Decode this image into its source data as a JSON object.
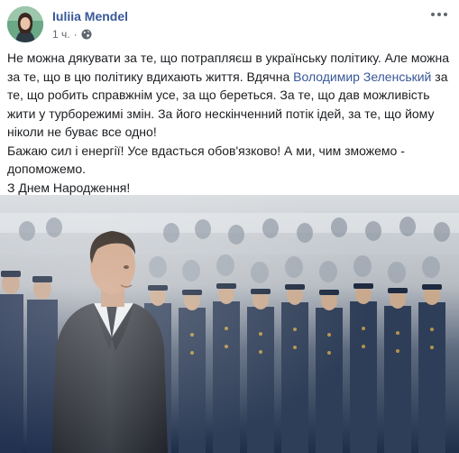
{
  "post": {
    "author": "Iuliia Mendel",
    "time": "1 ч.",
    "separator": "·",
    "privacy_icon": "globe-icon",
    "menu_icon": "more-options-icon",
    "text": {
      "p1_part1": "Не можна дякувати за те, що потрапляєш в українську політику. Але можна за те, що в цю політику вдихають життя. Вдячна ",
      "mention": "Володимир Зеленський",
      "p1_part2": " за те, що робить справжнім усе, за що береться. За те, що дав можливість жити у турборежимі змін. За його нескінченний потік ідей, за те, що йому ніколи не буває все одно!",
      "p2": "Бажаю сил і енергії! Усе вдасться обов'язково! А ми, чим зможемо - допоможемо.",
      "p3": "З Днем Народження!"
    },
    "colors": {
      "link": "#385898",
      "text": "#1c1e21",
      "meta": "#616770"
    }
  }
}
